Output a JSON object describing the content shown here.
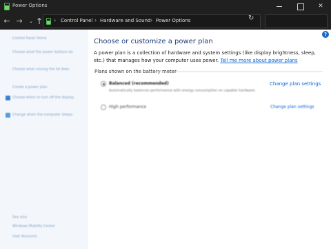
{
  "window": {
    "title": "Power Options",
    "min_label": "",
    "max_label": "",
    "close_label": "✕"
  },
  "nav": {
    "back": "←",
    "forward": "→",
    "recent": "⌄",
    "up": "↑",
    "breadcrumbs": [
      "Control Panel",
      "Hardware and Sound",
      "Power Options"
    ],
    "separator": "›",
    "dropdown": "⌄",
    "refresh": "↻",
    "search_placeholder": ""
  },
  "sidebar": {
    "items": [
      "Control Panel Home",
      "Choose what the power buttons do",
      "Choose what closing the lid does",
      "Create a power plan",
      "Choose when to turn off the display",
      "Change when the computer sleeps"
    ],
    "see_also_label": "See also",
    "see_also_items": [
      "Windows Mobility Center",
      "User Accounts"
    ]
  },
  "main": {
    "help": "?",
    "title": "Choose or customize a power plan",
    "description": "A power plan is a collection of hardware and system settings (like display brightness, sleep, etc.) that manages how your computer uses power.",
    "description_link": "Tell me more about power plans",
    "section_label": "Plans shown on the battery meter",
    "plans": [
      {
        "name": "Balanced (recommended)",
        "description": "Automatically balances performance with energy consumption on capable hardware.",
        "selected": true,
        "link": "Change plan settings"
      },
      {
        "name": "High performance",
        "selected": false,
        "link": "Change plan settings"
      }
    ]
  },
  "colors": {
    "titlebar_bg": "#202020",
    "content_bg": "#ffffff",
    "sidebar_bg": "#f3f7fc",
    "title_color": "#1e3d78",
    "link_color": "#0a64d6"
  }
}
